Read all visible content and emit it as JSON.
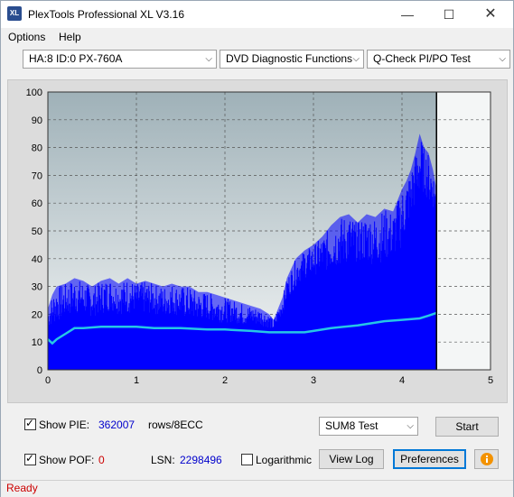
{
  "window": {
    "title": "PlexTools Professional XL V3.16",
    "icon_text": "XL"
  },
  "menu": [
    {
      "label": "Options",
      "accel": "O"
    },
    {
      "label": "Help",
      "accel": "H"
    }
  ],
  "selectors": {
    "drive": "HA:8 ID:0  PX-760A",
    "function": "DVD Diagnostic Functions",
    "test": "Q-Check PI/PO Test"
  },
  "chart_data": {
    "type": "area",
    "ylim": [
      0,
      100
    ],
    "xlim": [
      0,
      5
    ],
    "y_ticks": [
      "0",
      "10",
      "20",
      "30",
      "40",
      "50",
      "60",
      "70",
      "80",
      "90",
      "100"
    ],
    "x_ticks": [
      "0",
      "1",
      "2",
      "3",
      "4",
      "5"
    ],
    "grid": true,
    "end_marker_x": 4.39,
    "series": [
      {
        "role": "pie-peaks",
        "color": "#0000ff",
        "x": [
          0.0,
          0.05,
          0.1,
          0.2,
          0.3,
          0.4,
          0.5,
          0.6,
          0.7,
          0.8,
          0.9,
          1.0,
          1.1,
          1.2,
          1.3,
          1.4,
          1.5,
          1.6,
          1.7,
          1.8,
          1.9,
          2.0,
          2.1,
          2.2,
          2.3,
          2.4,
          2.5,
          2.55,
          2.6,
          2.65,
          2.7,
          2.8,
          2.9,
          3.0,
          3.1,
          3.2,
          3.3,
          3.4,
          3.5,
          3.6,
          3.7,
          3.8,
          3.9,
          4.0,
          4.05,
          4.1,
          4.15,
          4.2,
          4.25,
          4.3,
          4.35,
          4.39
        ],
        "values": [
          22,
          27,
          30,
          31,
          33,
          32,
          30,
          32,
          33,
          31,
          33,
          31,
          32,
          31,
          30,
          31,
          30,
          30,
          28,
          28,
          27,
          26,
          25,
          24,
          23,
          22,
          20,
          18,
          22,
          26,
          33,
          40,
          43,
          45,
          48,
          52,
          55,
          56,
          53,
          56,
          55,
          58,
          57,
          65,
          68,
          72,
          78,
          85,
          80,
          78,
          72,
          65
        ]
      },
      {
        "role": "pie-base",
        "color": "#0000ff",
        "x": [
          0.0,
          0.1,
          0.2,
          0.3,
          0.4,
          0.5,
          0.6,
          0.7,
          0.8,
          0.9,
          1.0,
          1.1,
          1.2,
          1.3,
          1.4,
          1.5,
          1.6,
          1.7,
          1.8,
          1.9,
          2.0,
          2.1,
          2.2,
          2.3,
          2.4,
          2.5,
          2.55,
          2.6,
          2.65,
          2.7,
          2.8,
          2.9,
          3.0,
          3.1,
          3.2,
          3.3,
          3.4,
          3.5,
          3.6,
          3.7,
          3.8,
          3.9,
          4.0,
          4.05,
          4.1,
          4.15,
          4.2,
          4.25,
          4.3,
          4.35,
          4.39
        ],
        "values": [
          15,
          17,
          19,
          20,
          20,
          19,
          20,
          21,
          20,
          20,
          21,
          20,
          20,
          19,
          20,
          19,
          18,
          18,
          18,
          17,
          17,
          17,
          16,
          16,
          16,
          15,
          14,
          17,
          20,
          25,
          30,
          33,
          34,
          35,
          36,
          37,
          38,
          39,
          38,
          38,
          39,
          40,
          44,
          50,
          55,
          58,
          62,
          64,
          60,
          58,
          55
        ]
      },
      {
        "role": "pif-sum8-line",
        "color": "#26c6e6",
        "x": [
          0.0,
          0.05,
          0.1,
          0.2,
          0.3,
          0.4,
          0.6,
          0.8,
          1.0,
          1.2,
          1.5,
          1.8,
          2.0,
          2.3,
          2.5,
          2.7,
          2.9,
          3.0,
          3.2,
          3.5,
          3.8,
          4.0,
          4.2,
          4.3,
          4.39
        ],
        "values": [
          11,
          9.5,
          11,
          13,
          15,
          15,
          15.5,
          15.5,
          15.5,
          15,
          15,
          14.5,
          14.5,
          14,
          13.5,
          13.5,
          13.5,
          14,
          15,
          16,
          17.5,
          18,
          18.5,
          19.5,
          20.5
        ]
      }
    ]
  },
  "stats": {
    "show_pie_label": "Show PIE:",
    "pie_value": "362007",
    "rows_unit": "rows/8ECC",
    "show_pof_label": "Show POF:",
    "pof_value": "0",
    "lsn_label": "LSN:",
    "lsn_value": "2298496",
    "logarithmic_label": "Logarithmic"
  },
  "controls": {
    "sum_select": "SUM8 Test",
    "start": "Start",
    "view_log": "View Log",
    "preferences": "Preferences"
  },
  "status": {
    "text": "Ready",
    "color": "#cc0000"
  },
  "colors": {
    "pie_value": "#0000cc",
    "pof_value": "#cc0000",
    "lsn_value": "#0000cc",
    "accent": "#0078d7"
  }
}
